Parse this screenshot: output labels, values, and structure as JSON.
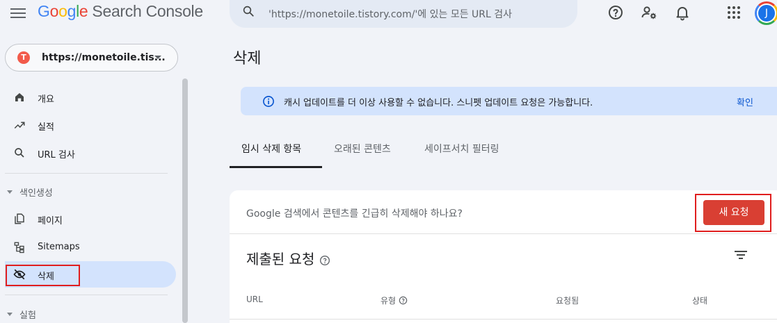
{
  "app": {
    "logo_letters": [
      "G",
      "o",
      "o",
      "g",
      "l",
      "e"
    ],
    "product_name": "Search Console"
  },
  "search": {
    "placeholder": "'https://monetoile.tistory.com/'에 있는 모든 URL 검사"
  },
  "header_icons": [
    "help-icon",
    "admin-settings-icon",
    "notifications-icon",
    "apps-grid-icon"
  ],
  "user": {
    "avatar_initial": "J"
  },
  "property": {
    "favicon_letter": "T",
    "url_display": "https://monetoile.tis...",
    "favicon_color": "#f25b4b"
  },
  "sidebar": {
    "items": [
      {
        "label": "개요",
        "icon": "home-icon"
      },
      {
        "label": "실적",
        "icon": "trending-up-icon"
      },
      {
        "label": "URL 검사",
        "icon": "search-icon"
      },
      {
        "label": "페이지",
        "icon": "pages-icon"
      },
      {
        "label": "Sitemaps",
        "icon": "sitemap-icon"
      },
      {
        "label": "삭제",
        "icon": "visibility-off-icon",
        "active": true
      }
    ],
    "sections": [
      "색인생성",
      "실험"
    ]
  },
  "main": {
    "title": "삭제",
    "banner": {
      "text": "캐시 업데이트를 더 이상 사용할 수 없습니다. 스니펫 업데이트 요청은 가능합니다.",
      "action": "확인"
    },
    "tabs": [
      {
        "label": "임시 삭제 항목",
        "active": true
      },
      {
        "label": "오래된 콘텐츠"
      },
      {
        "label": "세이프서치 필터링"
      }
    ],
    "card": {
      "question": "Google 검색에서 콘텐츠를 긴급히 삭제해야 하나요?",
      "new_request_label": "새 요청",
      "submitted_title": "제출된 요청",
      "columns": [
        "URL",
        "유형",
        "요청됨",
        "상태"
      ]
    }
  },
  "colors": {
    "accent_blue": "#0b57d0",
    "active_bg": "#d3e3fd",
    "danger_red": "#d93f33",
    "highlight_box": "#e01e1e"
  }
}
